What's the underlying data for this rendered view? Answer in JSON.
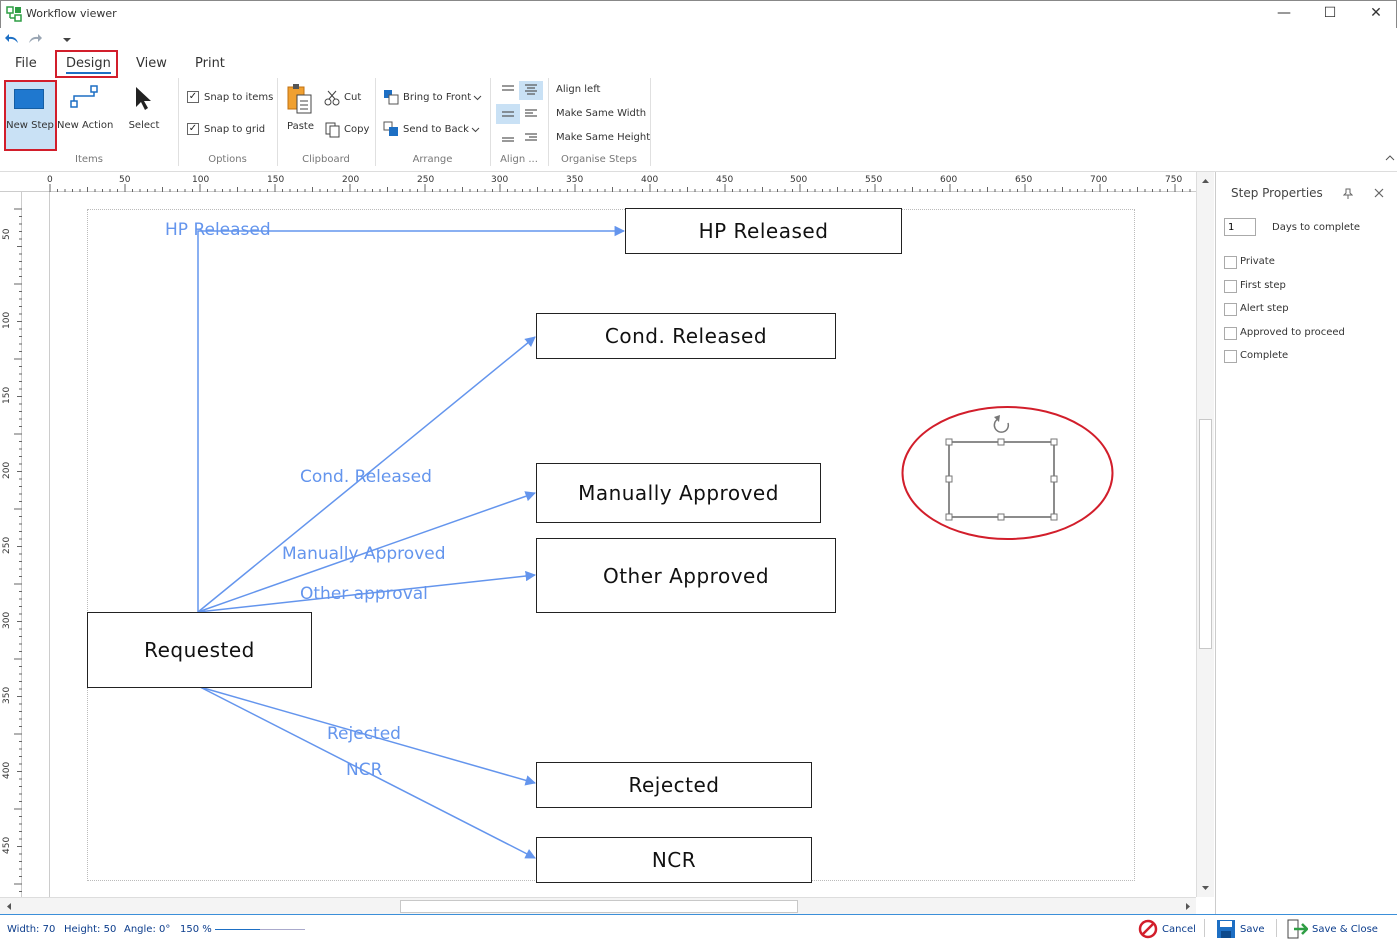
{
  "window": {
    "title": "Workflow viewer",
    "minimize": "—",
    "maximize": "☐",
    "close": "✕"
  },
  "menu": {
    "tabs": [
      "File",
      "Design",
      "View",
      "Print"
    ]
  },
  "ribbon": {
    "items_group": {
      "label": "Items",
      "new_step": "New Step",
      "new_action": "New Action",
      "select": "Select"
    },
    "options_group": {
      "label": "Options",
      "snap_items": "Snap to items",
      "snap_grid": "Snap to grid",
      "snap_items_checked": true,
      "snap_grid_checked": true
    },
    "clipboard_group": {
      "label": "Clipboard",
      "paste": "Paste",
      "cut": "Cut",
      "copy": "Copy"
    },
    "arrange_group": {
      "label": "Arrange",
      "bring_front": "Bring to Front",
      "send_back": "Send to Back"
    },
    "align_group": {
      "label": "Align ..."
    },
    "organise_group": {
      "label": "Organise Steps",
      "align_left": "Align left",
      "same_width": "Make Same Width",
      "same_height": "Make Same Height"
    }
  },
  "rulers": {
    "top": [
      "0",
      "50",
      "100",
      "150",
      "200",
      "250",
      "300",
      "350",
      "400",
      "450",
      "500",
      "550",
      "600",
      "650",
      "700",
      "750"
    ],
    "left": [
      "50",
      "100",
      "150",
      "200",
      "250",
      "300",
      "350",
      "400",
      "450"
    ]
  },
  "diagram": {
    "steps": {
      "hp_released": "HP Released",
      "cond_released": "Cond. Released",
      "manually_approved": "Manually Approved",
      "other_approved": "Other Approved",
      "requested": "Requested",
      "rejected": "Rejected",
      "ncr": "NCR"
    },
    "actions": {
      "hp_released": "HP Released",
      "cond_released": "Cond. Released",
      "manually_approved": "Manually Approved",
      "other_approval": "Other approval",
      "rejected": "Rejected",
      "ncr": "NCR"
    },
    "connector_color": "#6495ED",
    "highlight_color": "#D21E2B"
  },
  "properties": {
    "title": "Step Properties",
    "days_value": "1",
    "days_label": "Days to complete",
    "checkboxes": [
      "Private",
      "First step",
      "Alert step",
      "Approved to proceed",
      "Complete"
    ]
  },
  "status": {
    "width": "Width: 70",
    "height": "Height: 50",
    "angle": "Angle: 0°",
    "zoom": "150 %",
    "zoom_fraction": 0.5,
    "cancel": "Cancel",
    "save": "Save",
    "save_close": "Save & Close"
  }
}
